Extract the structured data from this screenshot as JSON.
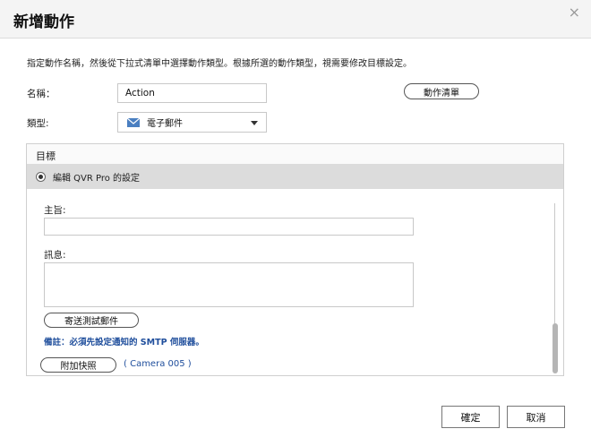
{
  "dialog": {
    "title": "新增動作",
    "close_glyph": "×"
  },
  "description": "指定動作名稱，然後從下拉式清單中選擇動作類型。根據所選的動作類型，視需要修改目標設定。",
  "name_field": {
    "label": "名稱：",
    "value": "Action"
  },
  "action_list_button": "動作清單",
  "type_field": {
    "label": "類型:",
    "selected": "電子郵件",
    "icon": "envelope-icon"
  },
  "target": {
    "header": "目標",
    "option": "編輯 QVR Pro 的設定",
    "subject_label": "主旨:",
    "subject_value": "",
    "message_label": "訊息:",
    "message_value": "",
    "send_test_button": "寄送測試郵件",
    "note": "備註：必須先設定通知的 SMTP 伺服器。"
  },
  "snapshot_button": "附加快照",
  "camera_link": "( Camera 005 )",
  "footer": {
    "confirm": "確定",
    "cancel": "取消"
  },
  "colors": {
    "accent_link": "#1f4e9c",
    "selected_row_bg": "#dcdcdc",
    "envelope_icon": "#4a7fc1"
  }
}
